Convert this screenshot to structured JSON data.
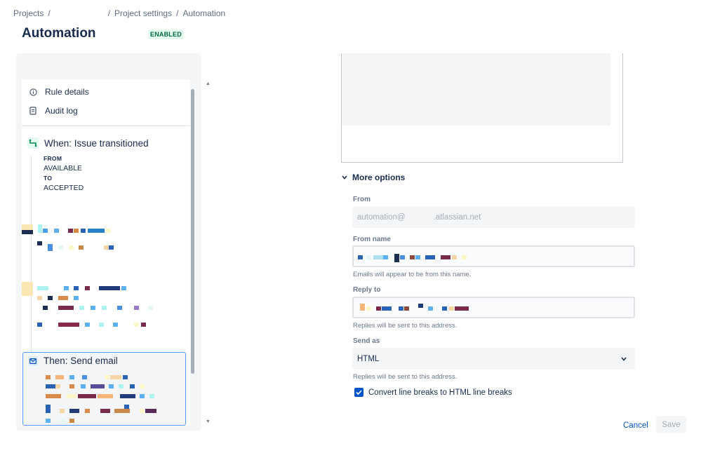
{
  "breadcrumb": {
    "projects": "Projects",
    "sep1": "/",
    "sep2": "/",
    "settings": "Project settings",
    "sep3": "/",
    "current": "Automation"
  },
  "header": {
    "title": "Automation",
    "status": "ENABLED"
  },
  "rule_panel": {
    "menu": [
      {
        "label": "Rule details",
        "icon": "info-icon"
      },
      {
        "label": "Audit log",
        "icon": "document-icon"
      }
    ],
    "trigger": {
      "title": "When: Issue transitioned",
      "from_label": "FROM",
      "from_value": "AVAILABLE",
      "to_label": "TO",
      "to_value": "ACCEPTED",
      "icon": "transition-icon"
    },
    "action": {
      "title": "Then: Send email",
      "icon": "email-icon"
    }
  },
  "form": {
    "more_options": "More options",
    "from": {
      "label": "From",
      "value_prefix": "automation@",
      "value_suffix": ".atlassian.net"
    },
    "from_name": {
      "label": "From name",
      "helper": "Emails will appear to be from this name."
    },
    "reply_to": {
      "label": "Reply to",
      "helper": "Replies will be sent to this address."
    },
    "send_as": {
      "label": "Send as",
      "value": "HTML",
      "helper": "Replies will be sent to this address."
    },
    "convert_line_breaks": {
      "label": "Convert line breaks to HTML line breaks",
      "checked": true
    },
    "cancel_label": "Cancel",
    "save_label": "Save"
  },
  "colors": {
    "primary": "#0052cc",
    "enabled_text": "#006644",
    "enabled_bg": "#e3fcef",
    "selection_border": "#4c9aff"
  }
}
